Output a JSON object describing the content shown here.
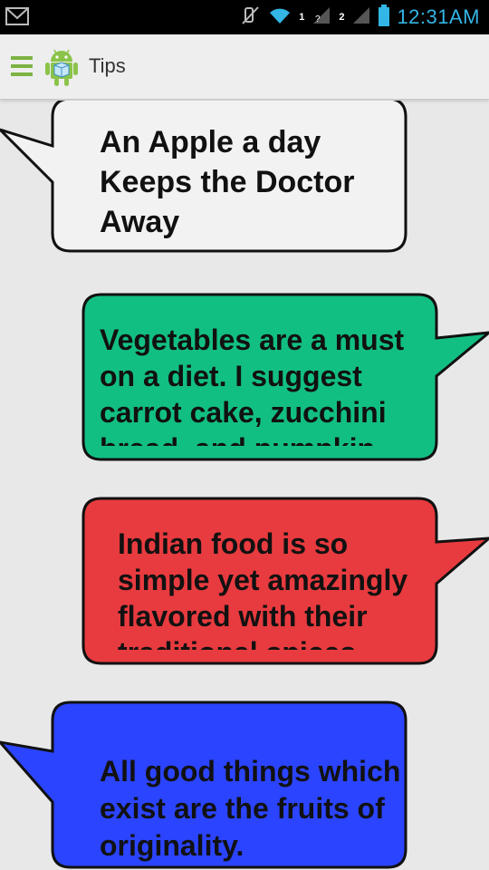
{
  "status_bar": {
    "clock": "12:31AM",
    "sim1_label": "1",
    "sim2_label": "2",
    "icons": [
      "gmail-icon",
      "mute-icon",
      "wifi-icon",
      "signal-icon",
      "battery-icon"
    ],
    "clock_color": "#33b5e5"
  },
  "action_bar": {
    "title": "Tips",
    "icons": [
      "menu-icon",
      "android-icon"
    ],
    "menu_color": "#7cb342"
  },
  "tips": [
    {
      "text": "An Apple  a day Keeps  the Doctor Away",
      "color": "#f2f2f2",
      "tail": "left"
    },
    {
      "text": "Vegetables are a must on a diet. I suggest carrot cake, zucchini bread, and pumpkin",
      "color": "#12bf82",
      "tail": "right"
    },
    {
      "text": "Indian food is so simple yet amazingly flavored with their traditional spices",
      "color": "#e83b3f",
      "tail": "right"
    },
    {
      "text": "All good things which exist are the fruits of originality.",
      "color": "#2b44ff",
      "tail": "left"
    }
  ]
}
